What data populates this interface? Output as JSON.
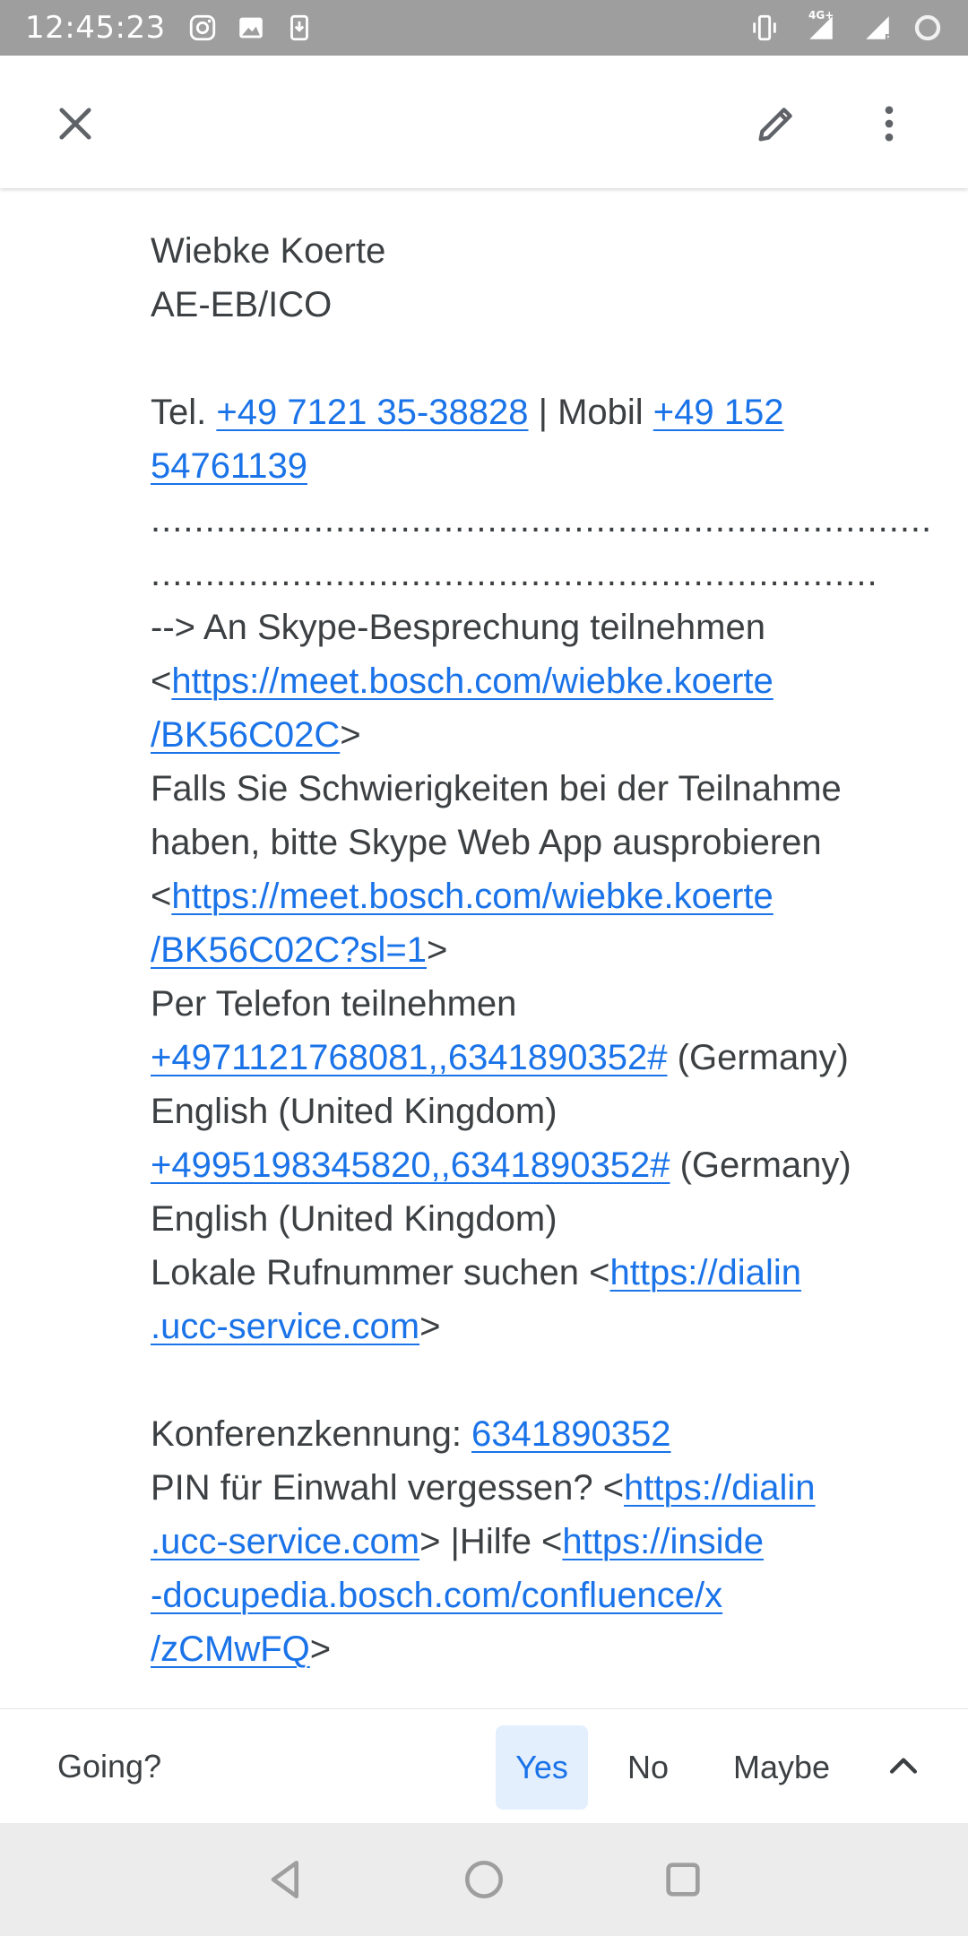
{
  "status_bar": {
    "time": "12:45:23",
    "network": "4G+",
    "roaming": "R"
  },
  "app_bar": {
    "close_icon": "close-icon",
    "edit_icon": "pencil-icon",
    "more_icon": "more-vert-icon"
  },
  "body": {
    "name": "Wiebke Koerte",
    "department": "AE-EB/ICO",
    "tel_prefix": "Tel. ",
    "tel_number": "+49 7121 35-38828",
    "mobile_prefix": " | Mobil ",
    "mobile_number_1": "+49 152",
    "mobile_number_2": "54761139",
    "dots_1": "........................................................................",
    "dots_2": "...................................................................",
    "skype_join": "--> An Skype-Besprechung teilnehmen",
    "lt": "<",
    "gt": ">",
    "skype_link_1": "https://meet.bosch.com/wiebke.koerte",
    "skype_link_2": "/BK56C02C",
    "trouble_1": "Falls Sie Schwierigkeiten bei der Teilnahme",
    "trouble_2": "haben, bitte Skype Web App ausprobieren",
    "webapp_link_1": "https://meet.bosch.com/wiebke.koerte",
    "webapp_link_2": "/BK56C02C?sl=1",
    "phone_join": "Per Telefon teilnehmen",
    "phone_1": "+4971121768081,,6341890352#",
    "phone_1_suffix": " (Germany)",
    "phone_1_lang": "English (United Kingdom)",
    "phone_2": "+4995198345820,,6341890352#",
    "phone_2_suffix": " (Germany)",
    "phone_2_lang": "English (United Kingdom)",
    "local_number": "Lokale Rufnummer suchen ",
    "dialin_link_1": "https://dialin",
    "dialin_link_2": ".ucc-service.com",
    "conf_label": "Konferenzkennung: ",
    "conf_id": "6341890352",
    "pin_label": " PIN für Einwahl vergessen? ",
    "pin_link_1": "https://dialin",
    "pin_link_2": ".ucc-service.com",
    "help_label": ">  |Hilfe <",
    "help_link_1": "https://inside",
    "help_link_2": "-docupedia.bosch.com/confluence/x",
    "help_link_3": "/zCMwFQ"
  },
  "rsvp": {
    "label": "Going?",
    "yes": "Yes",
    "no": "No",
    "maybe": "Maybe",
    "selected": "Yes",
    "accent": "#1a73e8",
    "selected_bg": "#e3effd"
  },
  "nav_bar": {
    "back_icon": "back-triangle-icon",
    "home_icon": "home-circle-icon",
    "recents_icon": "recents-square-icon"
  }
}
